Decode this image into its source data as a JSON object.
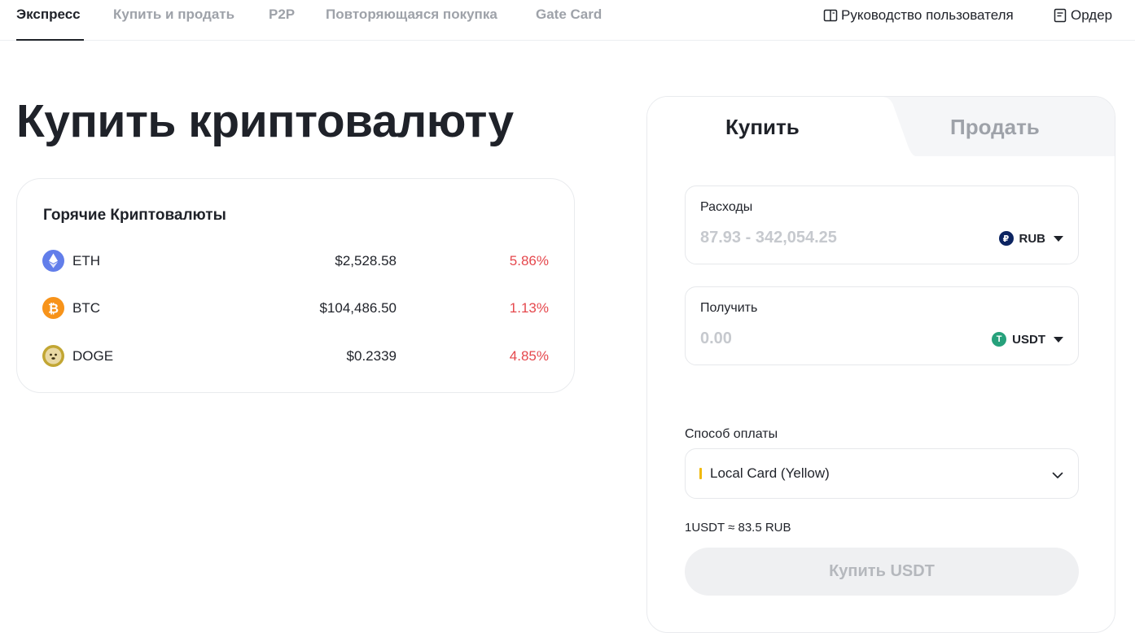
{
  "nav": {
    "tabs": [
      {
        "label": "Экспресс",
        "active": true
      },
      {
        "label": "Купить и продать",
        "active": false
      },
      {
        "label": "P2P",
        "active": false
      },
      {
        "label": "Повторяющаяся покупка",
        "active": false
      },
      {
        "label": "Gate Card",
        "active": false
      }
    ],
    "guide_label": "Руководство пользователя",
    "orders_label": "Ордер"
  },
  "page": {
    "title": "Купить криптовалюту"
  },
  "hot": {
    "title": "Горячие Криптовалюты",
    "coins": [
      {
        "symbol": "ETH",
        "price": "$2,528.58",
        "change": "5.86%",
        "icon_color": "#627eea",
        "icon": "ethereum-icon"
      },
      {
        "symbol": "BTC",
        "price": "$104,486.50",
        "change": "1.13%",
        "icon_color": "#f7931a",
        "icon": "bitcoin-icon"
      },
      {
        "symbol": "DOGE",
        "price": "$0.2339",
        "change": "4.85%",
        "icon_color": "#c2a633",
        "icon": "dogecoin-icon"
      }
    ]
  },
  "trade": {
    "buy_tab": "Купить",
    "sell_tab": "Продать",
    "spend": {
      "label": "Расходы",
      "placeholder": "87.93 - 342,054.25",
      "currency": "RUB",
      "currency_glyph": "₽",
      "currency_color": "#0c2461"
    },
    "receive": {
      "label": "Получить",
      "placeholder": "0.00",
      "currency": "USDT",
      "currency_glyph": "T",
      "currency_color": "#26a17b"
    },
    "payment": {
      "label": "Способ оплаты",
      "value": "Local Card (Yellow)",
      "accent": "#f0b90b"
    },
    "rate": "1USDT ≈ 83.5 RUB",
    "submit_label": "Купить USDT"
  },
  "colors": {
    "negative": "#e5484d",
    "text": "#1f2229",
    "muted": "#9ea2a9"
  }
}
